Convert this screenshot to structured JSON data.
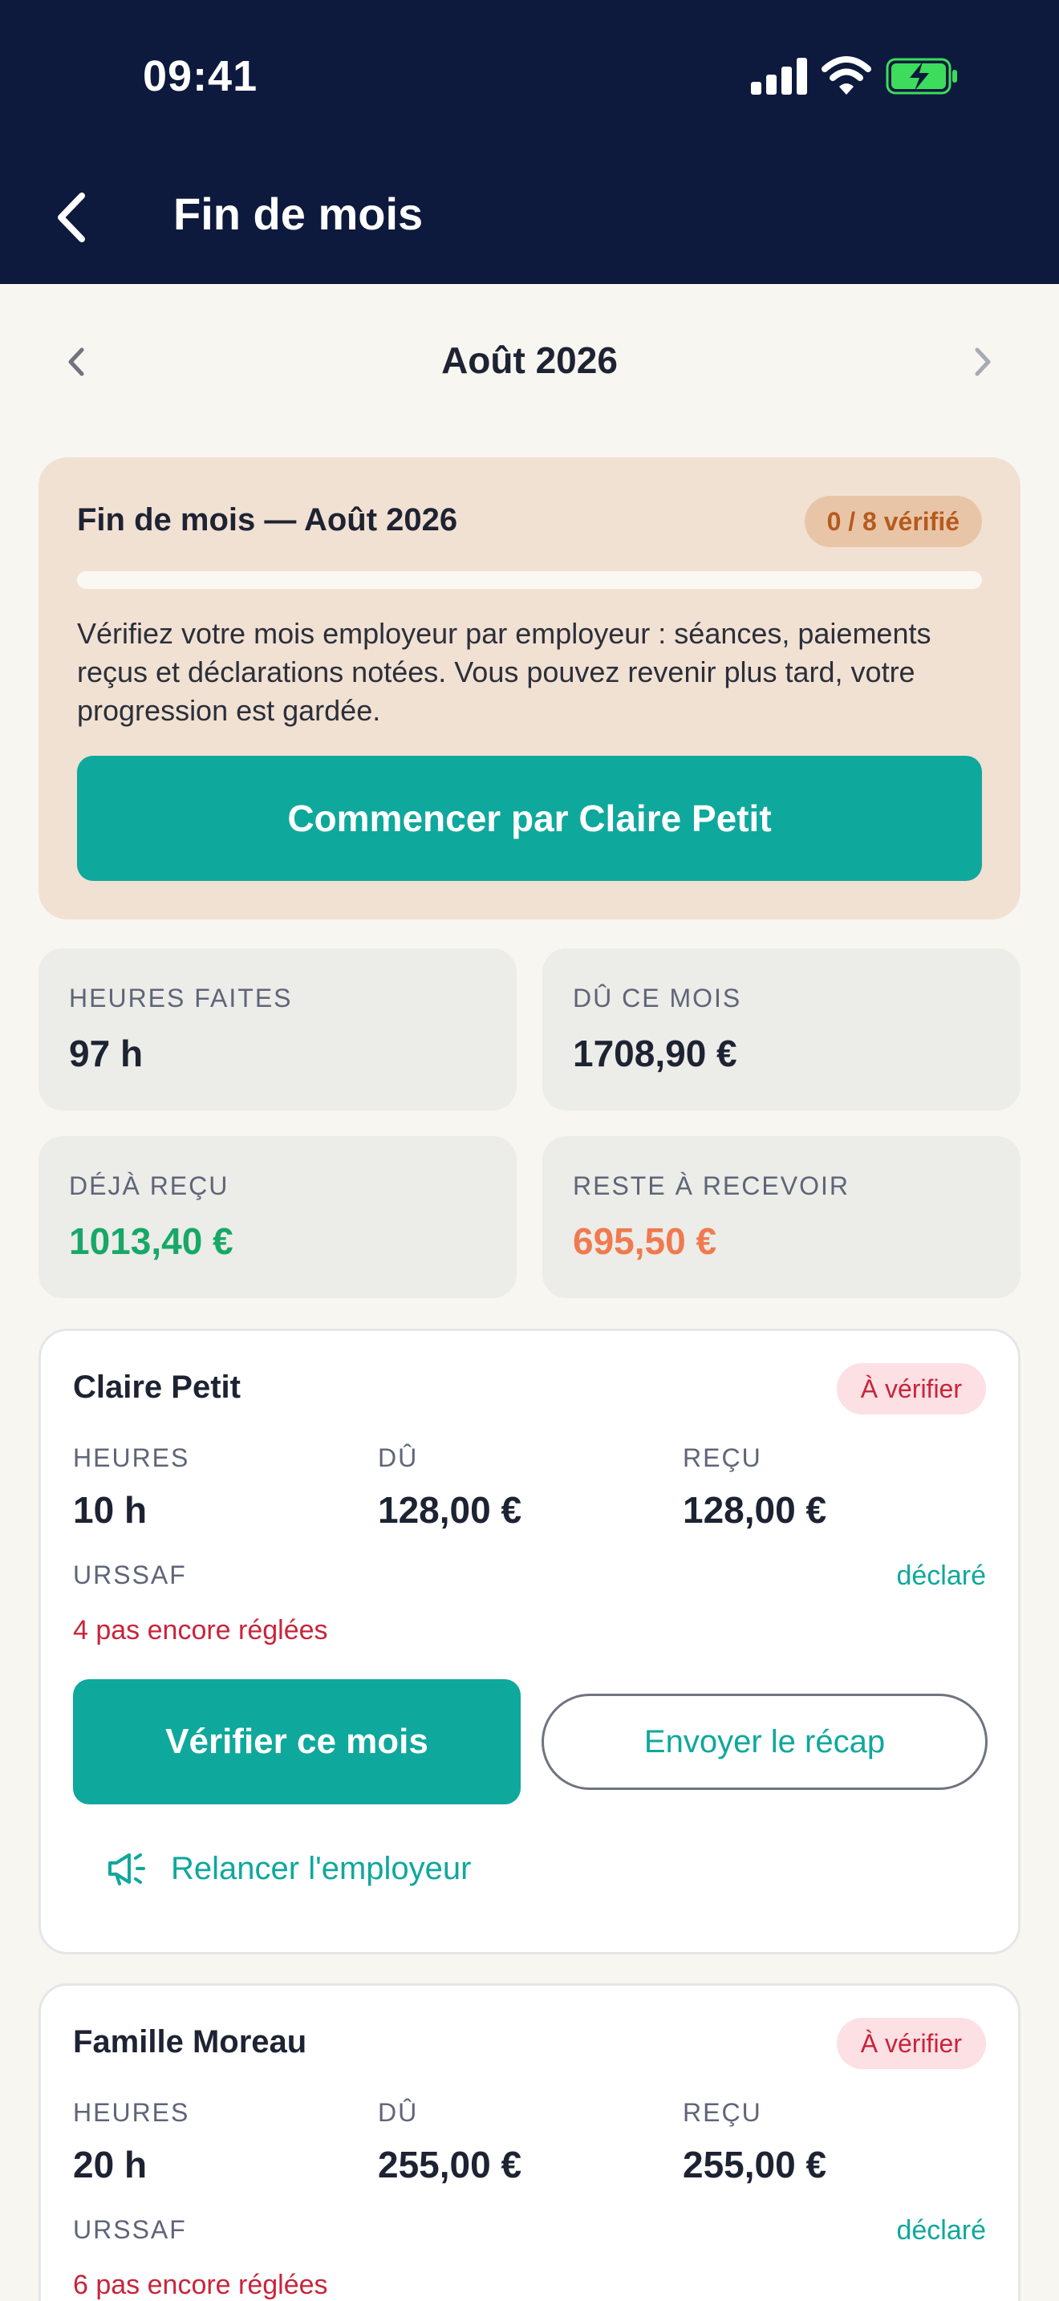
{
  "status_bar": {
    "time": "09:41"
  },
  "header": {
    "title": "Fin de mois"
  },
  "month_nav": {
    "label": "Août 2026"
  },
  "summary": {
    "title": "Fin de mois — Août 2026",
    "badge": "0 / 8 vérifié",
    "progress_fraction": 0,
    "description": "Vérifiez votre mois employeur par employeur : séances, paiements reçus et déclarations notées. Vous pouvez revenir plus tard, votre progression est gardée.",
    "cta_label": "Commencer par Claire Petit"
  },
  "stats": [
    {
      "label": "HEURES FAITES",
      "value": "97 h",
      "color": "#1E2333"
    },
    {
      "label": "DÛ CE MOIS",
      "value": "1708,90 €",
      "color": "#1E2333"
    },
    {
      "label": "DÉJÀ REÇU",
      "value": "1013,40 €",
      "color": "#17A867"
    },
    {
      "label": "RESTE À RECEVOIR",
      "value": "695,50 €",
      "color": "#F07A50"
    }
  ],
  "employers": [
    {
      "name": "Claire Petit",
      "status": "À vérifier",
      "hours_label": "HEURES",
      "hours": "10 h",
      "due_label": "DÛ",
      "due": "128,00 €",
      "received_label": "REÇU",
      "received": "128,00 €",
      "urssaf_label": "URSSAF",
      "urssaf_status": "déclaré",
      "unpaid": "4 pas encore réglées",
      "verify_label": "Vérifier ce mois",
      "recap_label": "Envoyer le récap",
      "relance_label": "Relancer l'employeur"
    },
    {
      "name": "Famille Moreau",
      "status": "À vérifier",
      "hours_label": "HEURES",
      "hours": "20 h",
      "due_label": "DÛ",
      "due": "255,00 €",
      "received_label": "REÇU",
      "received": "255,00 €",
      "urssaf_label": "URSSAF",
      "urssaf_status": "déclaré",
      "unpaid": "6 pas encore réglées"
    }
  ],
  "colors": {
    "header_bg": "#0D1A3D",
    "accent": "#0FA89C",
    "warning_bg": "#F1E1D3",
    "danger": "#C8243A",
    "battery_green": "#3DDC5C"
  },
  "icons": {
    "back": "chevron-left-icon",
    "prev": "chevron-left-icon",
    "next": "chevron-right-icon",
    "relance": "megaphone-icon"
  }
}
